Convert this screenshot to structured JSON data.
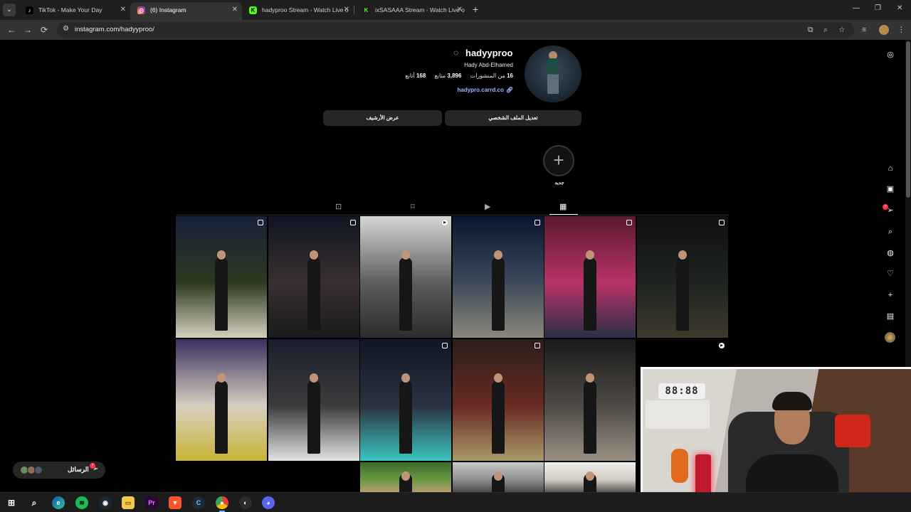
{
  "browser": {
    "tabs": [
      {
        "title": "TikTok - Make Your Day",
        "favicon": "tiktok-icon",
        "active": false
      },
      {
        "title": "(6) Instagram",
        "favicon": "instagram-icon",
        "active": true
      },
      {
        "title": "hadyproo Stream - Watch Live o",
        "favicon": "kick-icon",
        "active": false
      },
      {
        "title": "ixSASAAA Stream - Watch Live o",
        "favicon": "kick-icon",
        "active": false
      }
    ],
    "url": "instagram.com/hadyyproo/"
  },
  "profile": {
    "username": "hadyyproo",
    "full_name": "Hady Abd-Elhamed",
    "posts_count": "16",
    "posts_label": "من المنشورات",
    "followers_count": "3,896",
    "followers_label": "متابع",
    "following_count": "168",
    "following_label": "أتابع",
    "link": "hadypro.carrd.co",
    "edit_profile_button": "تعديل الملف الشخصي",
    "view_archive_button": "عرض الأرشيف",
    "new_highlight_label": "جديد"
  },
  "grid": {
    "posts": [
      {
        "type": "carousel",
        "palette": [
          "#17213a",
          "#2c3a1e",
          "#d5cfc0"
        ]
      },
      {
        "type": "carousel",
        "palette": [
          "#101522",
          "#3a2f30",
          "#1a1a1a"
        ]
      },
      {
        "type": "reel",
        "palette": [
          "#d6d6d6",
          "#5c5c5c",
          "#2c2c2c"
        ]
      },
      {
        "type": "carousel",
        "palette": [
          "#0b1430",
          "#3d4a5b",
          "#8b8778"
        ]
      },
      {
        "type": "carousel",
        "palette": [
          "#5a1a2e",
          "#b8326a",
          "#2a2f45"
        ]
      },
      {
        "type": "carousel",
        "palette": [
          "#101010",
          "#1e2420",
          "#3e3a2c"
        ]
      },
      {
        "type": "photo",
        "palette": [
          "#3b2f5e",
          "#d8cfc0",
          "#c7b437"
        ]
      },
      {
        "type": "photo",
        "palette": [
          "#1a1e2b",
          "#3c3c3c",
          "#e3e3e3"
        ]
      },
      {
        "type": "carousel",
        "palette": [
          "#0f1626",
          "#2a3340",
          "#3bc6c0"
        ]
      },
      {
        "type": "carousel",
        "palette": [
          "#2b1e1a",
          "#6a2a23",
          "#a89b68"
        ]
      },
      {
        "type": "photo",
        "palette": [
          "#1a1a1a",
          "#4f4a44",
          "#9a8f83"
        ]
      },
      {
        "type": "reel",
        "palette": [
          "#000000",
          "#000000",
          "#000000"
        ]
      }
    ],
    "partial_row": [
      {
        "palette": [
          "#3a6b2a",
          "#6c9a44",
          "#c89c7a"
        ]
      },
      {
        "palette": [
          "#c8c8c8",
          "#8c8c8c",
          "#3a3a3a"
        ]
      },
      {
        "palette": [
          "#f0efec",
          "#cfc8bf",
          "#3a3a3a"
        ]
      }
    ]
  },
  "right_rail": {
    "notifications_badge": "7",
    "icons": [
      "instagram-icon",
      "home-icon",
      "reels-icon",
      "messages-icon",
      "search-icon",
      "explore-icon",
      "heart-icon",
      "create-icon",
      "insights-icon",
      "profile-avatar"
    ]
  },
  "messages_pill": {
    "label": "الرسائل",
    "badge": "7"
  },
  "webcam": {
    "clock_text": "88:88"
  },
  "taskbar": {
    "apps": [
      "start",
      "search",
      "edge",
      "spotify",
      "steam",
      "explorer",
      "premiere",
      "brave",
      "capcut",
      "chrome",
      "obs",
      "discord"
    ]
  }
}
